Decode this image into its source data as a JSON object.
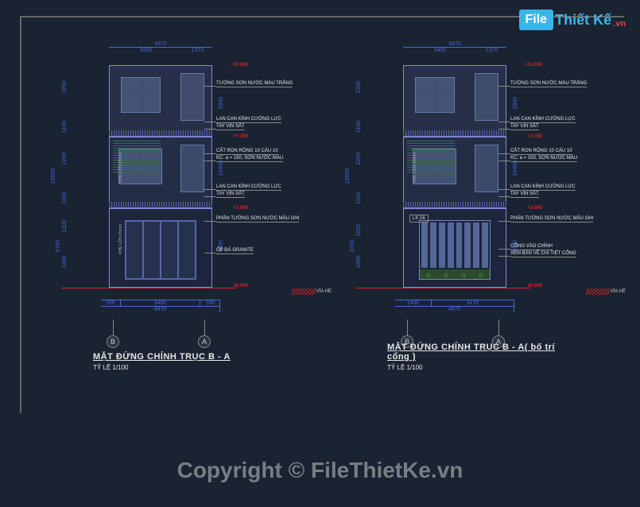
{
  "logo": {
    "box": "File",
    "text": "Thiết Kế",
    "suffix": ".vn"
  },
  "watermark": "Copyright © FileThietKe.vn",
  "elevations": {
    "left": {
      "title": "MẶT ĐỨNG CHÍNH TRỤC B - A",
      "scale": "TỶ LỆ 1/100"
    },
    "right": {
      "title": "MẶT ĐỨNG CHÍNH TRỤC B - A( bố trí cổng )",
      "scale": "TỶ LỆ 1/100"
    }
  },
  "dimensions": {
    "top_overall": "4970",
    "top_left": "3400",
    "top_right": "1370",
    "left_overall": "10650",
    "left_f3a": "2200",
    "left_f3b": "1100",
    "left_f2a": "2200",
    "left_f2b": "1100",
    "left_f1a": "1200",
    "left_f1b": "2450",
    "left_f1c": "3750",
    "right_offset": "10400",
    "right_f3": "3300",
    "right_f1": "3600",
    "gap": "1620",
    "bottom_1": "785",
    "bottom_2": "3400",
    "bottom_3": "785",
    "bottom_overall": "4970",
    "bottom_r1": "1400",
    "bottom_r2": "3170"
  },
  "annotations": {
    "wall_white": "TƯỜNG SƠN NƯỚC MÀU TRẮNG",
    "glass_rail": "LAN CAN KÍNH CƯỜNG LỰC",
    "iron_hand": "TAY VỊN SẮT",
    "louver": "CẮT RON RỘNG 10 CÁU 10",
    "louver2": "KC: a = 150, SƠN NƯỚC MÀU",
    "wall_grey": "PHẦN TƯỜNG SƠN NƯỚC MÀU GHI",
    "granite": "ỐP ĐÁ GRANITE",
    "gate": "CỔNG VÀO CHÍNH",
    "gate2": "XEM BẢN VẼ CHI TIẾT CỔNG",
    "curb": "VỈA HÈ",
    "khe": "KHE LỚN 15mm",
    "unit_label": "LK 56"
  },
  "levels": {
    "roof": "+10.650",
    "f3": "+7.350",
    "f2": "+3.600",
    "ground": "±0.000"
  },
  "axes": {
    "b": "B",
    "a": "A"
  }
}
